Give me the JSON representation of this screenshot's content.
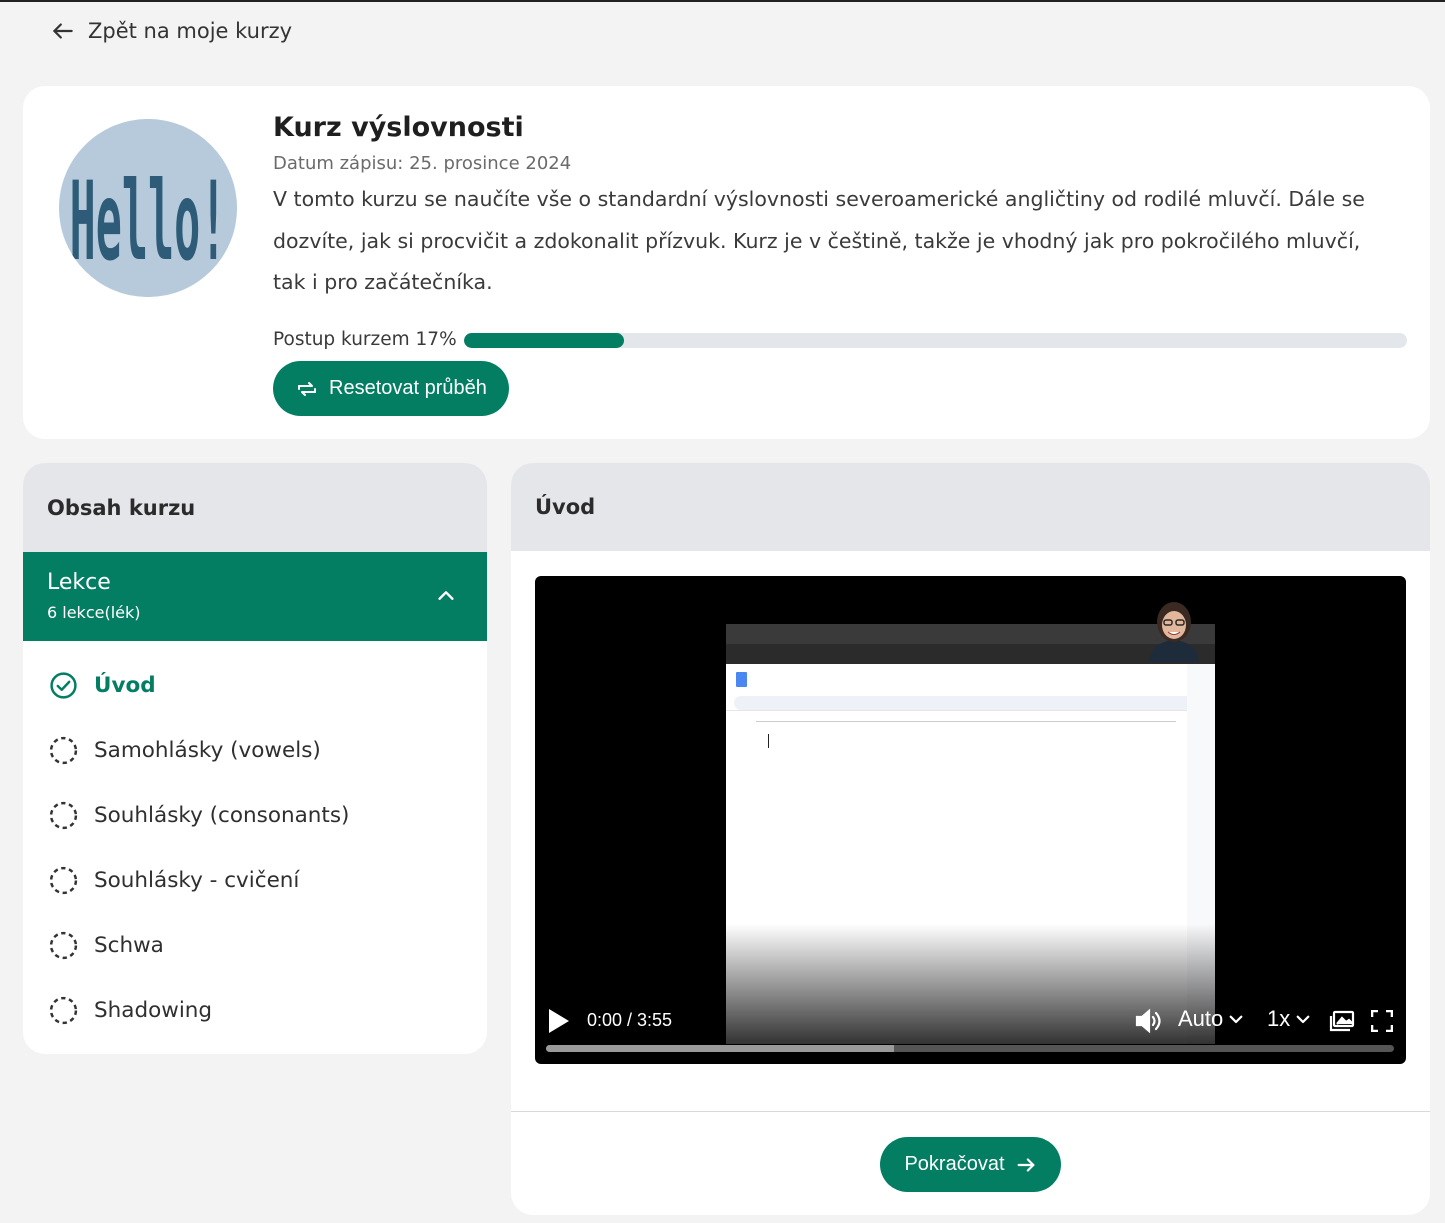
{
  "nav": {
    "back_label": "Zpět na moje kurzy"
  },
  "course": {
    "title": "Kurz výslovnosti",
    "enrolled": "Datum zápisu: 25. prosince 2024",
    "description": "V tomto kurzu se naučíte vše o standardní výslovnosti severoamerické angličtiny od rodilé mluvčí. Dále se dozvíte, jak si procvičit a zdokonalit přízvuk. Kurz je v češtině, takže je vhodný jak pro pokročilého mluvčí, tak i pro začátečníka.",
    "avatar_text": "Hello!",
    "progress_label": "Postup kurzem 17%",
    "progress_fraction": 0.17,
    "reset_label": "Resetovat průběh"
  },
  "sidebar": {
    "heading": "Obsah kurzu",
    "section": {
      "title": "Lekce",
      "count": "6 lekce(lék)"
    },
    "lessons": [
      {
        "label": "Úvod",
        "status": "completed"
      },
      {
        "label": "Samohlásky (vowels)",
        "status": "pending"
      },
      {
        "label": "Souhlásky (consonants)",
        "status": "pending"
      },
      {
        "label": "Souhlásky - cvičení",
        "status": "pending"
      },
      {
        "label": "Schwa",
        "status": "pending"
      },
      {
        "label": "Shadowing",
        "status": "pending"
      }
    ]
  },
  "main": {
    "heading": "Úvod",
    "video": {
      "time": "0:00 / 3:55",
      "quality": "Auto",
      "speed": "1x",
      "buffered_fraction": 0.41
    },
    "continue_label": "Pokračovat"
  },
  "colors": {
    "accent": "#047e63",
    "panel_header": "#e4e6ea",
    "background": "#f3f3f3"
  }
}
